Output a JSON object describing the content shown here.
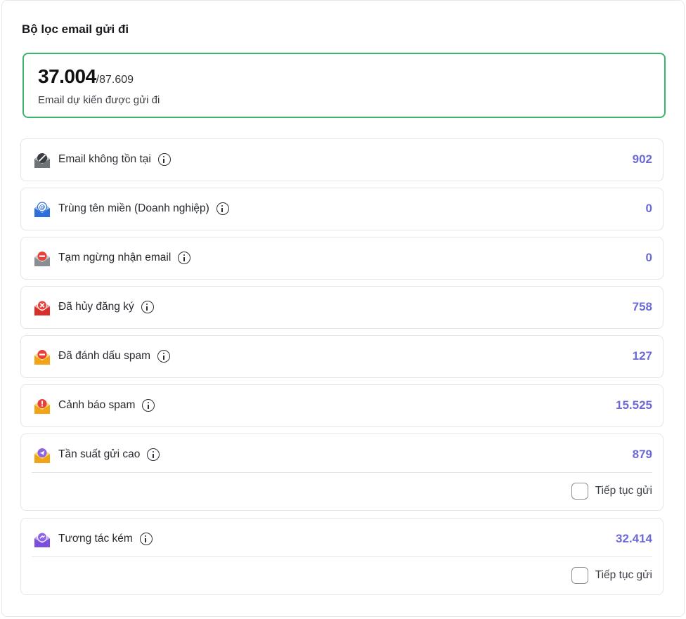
{
  "header": {
    "title": "Bộ lọc email gửi đi"
  },
  "summary": {
    "count": "37.004",
    "total": "/87.609",
    "caption": "Email dự kiến được gửi đi"
  },
  "filters": [
    {
      "label": "Email không tồn tại",
      "value": "902",
      "icon": "envelope-blocked-icon",
      "color": "#8d8f93"
    },
    {
      "label": "Trùng tên miền (Doanh nghiệp)",
      "value": "0",
      "icon": "envelope-at-icon",
      "color": "#3d7ff0"
    },
    {
      "label": "Tạm ngừng nhận email",
      "value": "0",
      "icon": "envelope-pause-icon",
      "color": "#9a9ca0"
    },
    {
      "label": "Đã hủy đăng ký",
      "value": "758",
      "icon": "envelope-unsubscribe-icon",
      "color": "#e8403a"
    },
    {
      "label": "Đã đánh dấu spam",
      "value": "127",
      "icon": "envelope-spam-marked-icon",
      "color": "#f5b21f"
    },
    {
      "label": "Cảnh báo spam",
      "value": "15.525",
      "icon": "envelope-spam-warning-icon",
      "color": "#f5b21f"
    },
    {
      "label": "Tần suất gửi cao",
      "value": "879",
      "icon": "envelope-high-frequency-icon",
      "color": "#f5b21f",
      "continue_label": "Tiếp tục gửi"
    },
    {
      "label": "Tương tác kém",
      "value": "32.414",
      "icon": "envelope-low-engagement-icon",
      "color": "#8e63e6",
      "continue_label": "Tiếp tục gửi"
    }
  ],
  "accent_color": "#6c6ad6",
  "summary_border_color": "#3cb46e"
}
